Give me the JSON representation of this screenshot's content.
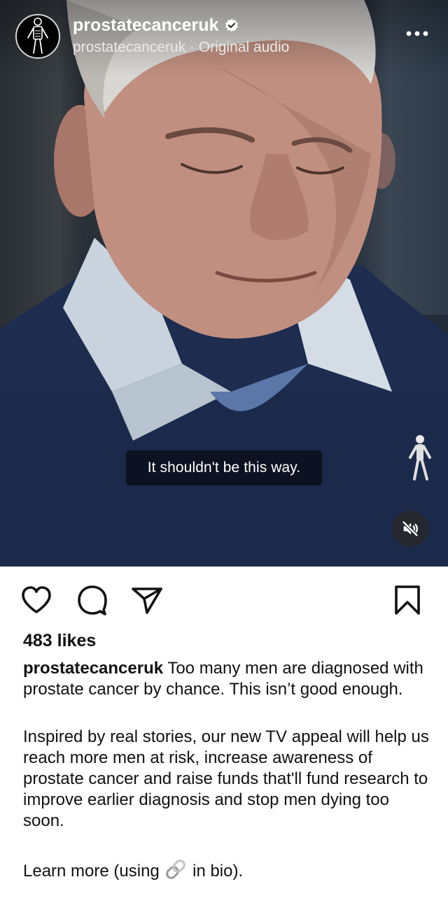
{
  "post": {
    "username": "prostatecanceruk",
    "subtitle": "prostatecanceruk · Original audio",
    "verified": true,
    "video_caption": "It shouldn't be this way."
  },
  "engagement": {
    "likes": "483 likes"
  },
  "caption": {
    "username": "prostatecanceruk",
    "first": "Too many men are diagnosed with prostate cancer by chance. This isn’t good enough.",
    "second": "Inspired by real stories, our new TV appeal will help us reach more men at risk, increase awareness of prostate cancer and raise funds that'll fund research to improve earlier diagnosis and stop men dying too soon.",
    "third_before": "Learn more (using",
    "third_after": "in bio)."
  },
  "icons": {
    "avatar": "skeleton-figure-logo",
    "verified": "verified-badge-icon",
    "more": "more-options-icon",
    "mute": "muted-speaker-icon",
    "like": "heart-icon",
    "comment": "comment-bubble-icon",
    "share": "paper-plane-icon",
    "save": "bookmark-icon",
    "link": "link-icon"
  }
}
